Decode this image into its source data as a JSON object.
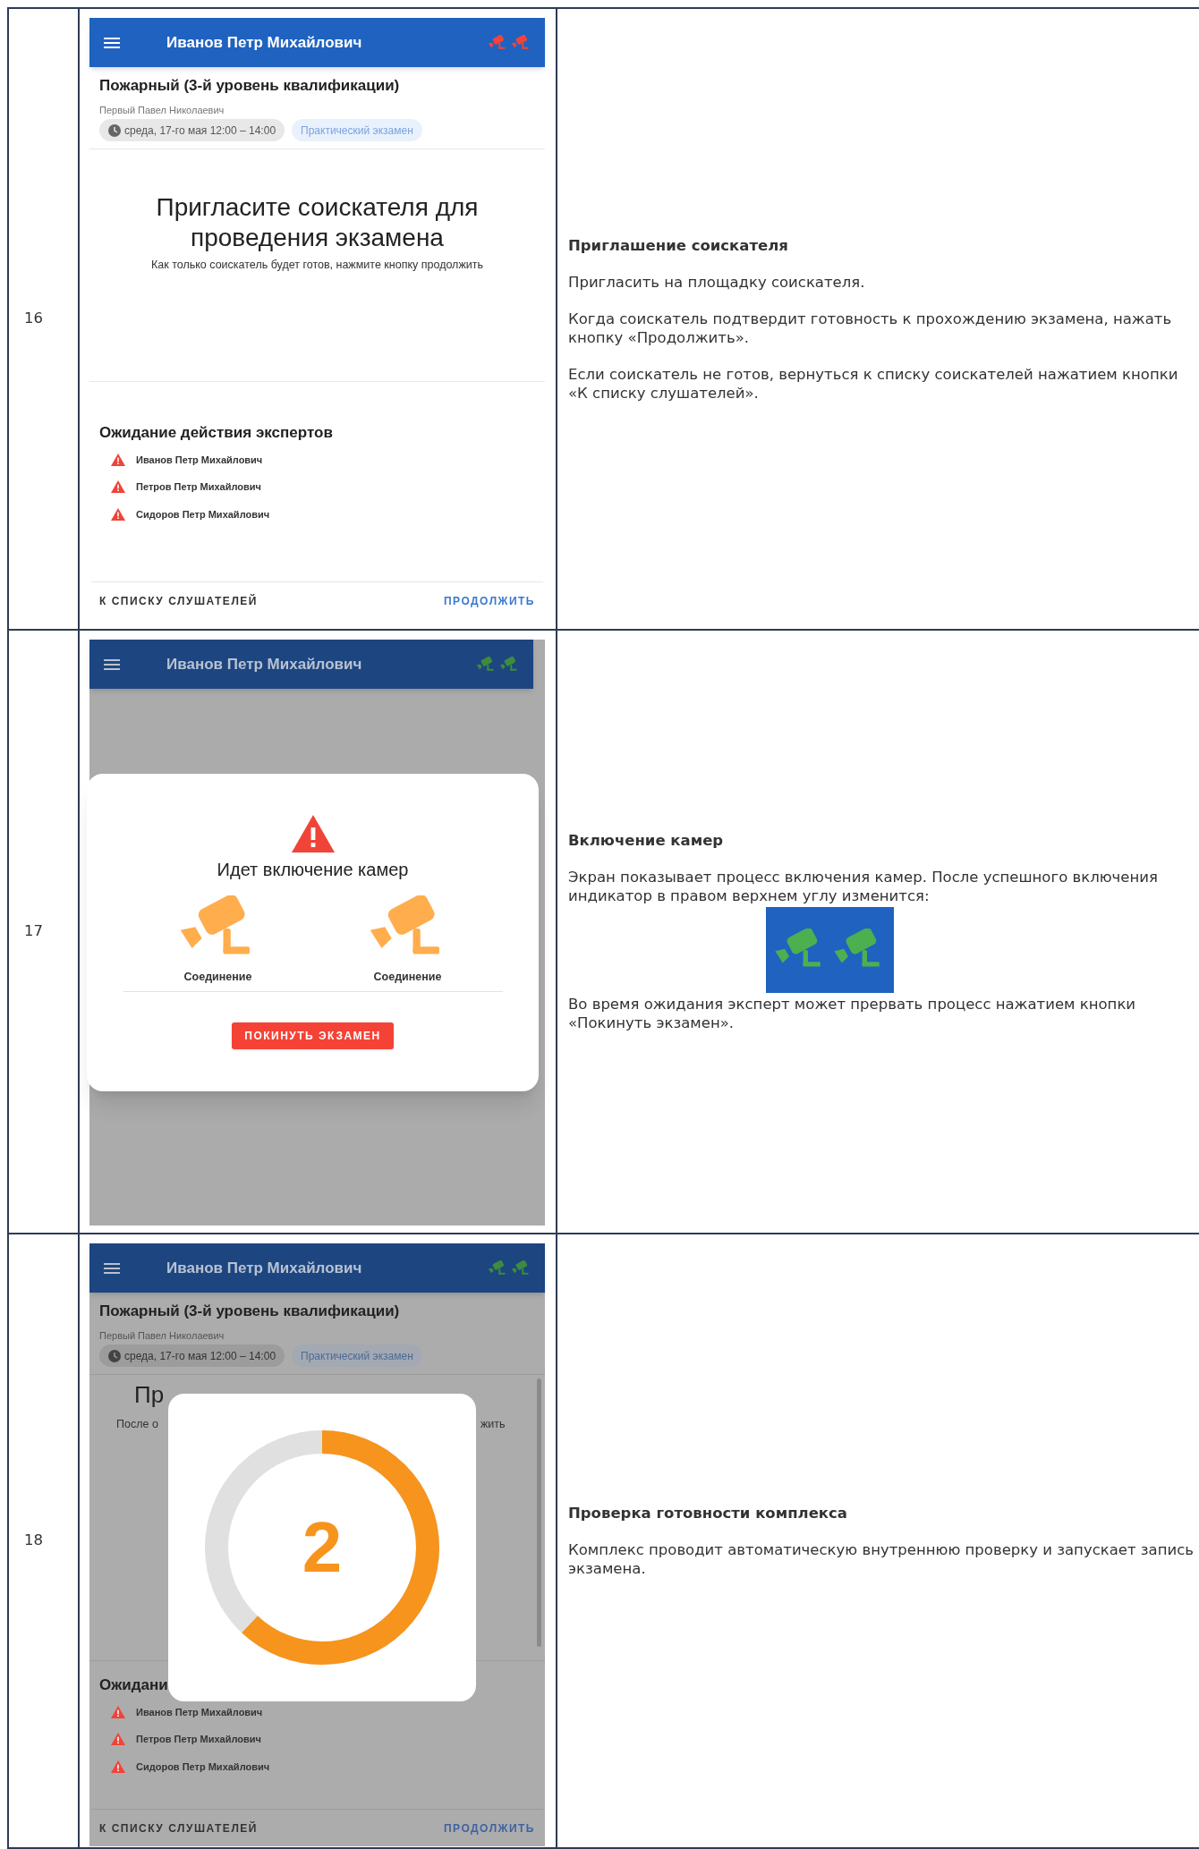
{
  "rows": [
    {
      "number": "16",
      "screen": {
        "kind": "invite",
        "dimmed": false,
        "header": {
          "name": "Иванов Петр Михайлович",
          "cameras_on": false
        },
        "exam": {
          "title": "Пожарный (3-й уровень квалификации)",
          "examiner": "Первый Павел Николаевич",
          "date": "среда, 17-го мая 12:00 – 14:00",
          "badge": "Практический экзамен"
        },
        "invite": {
          "heading": "Пригласите соискателя для проведения экзамена",
          "hint": "Как только соискатель будет готов, нажмите кнопку продолжить"
        },
        "experts": {
          "title": "Ожидание действия экспертов",
          "items": [
            "Иванов Петр Михайлович",
            "Петров Петр Михайлович",
            "Сидоров Петр Михайлович"
          ]
        },
        "footer": {
          "back": "К СПИСКУ СЛУШАТЕЛЕЙ",
          "next": "ПРОДОЛЖИТЬ"
        }
      },
      "description": {
        "title": "Приглашение соискателя",
        "paragraphs": [
          {
            "kind": "text",
            "text": "Пригласить на площадку соискателя."
          },
          {
            "kind": "text",
            "text": "Когда соискатель подтвердит готовность к прохождению экзамена, нажать кнопку «Продолжить»."
          },
          {
            "kind": "text",
            "text": "Если соискатель не готов, вернуться к списку соискателей нажатием кнопки «К списку слушателей»."
          }
        ]
      }
    },
    {
      "number": "17",
      "screen": {
        "kind": "cameras",
        "dimmed": true,
        "header": {
          "name": "Иванов Петр Михайлович",
          "cameras_on": true
        },
        "modal": {
          "title": "Идет включение камер",
          "cameras": [
            {
              "label": "Соединение"
            },
            {
              "label": "Соединение"
            }
          ],
          "button": "ПОКИНУТЬ ЭКЗАМЕН"
        }
      },
      "description": {
        "title": "Включение камер",
        "paragraphs": [
          {
            "kind": "text",
            "text": "Экран показывает процесс включения камер. После успешного включения индикатор в правом верхнем углу изменится:"
          },
          {
            "kind": "indicator",
            "cameras_on": true
          },
          {
            "kind": "text",
            "text": "Во время ожидания эксперт может прервать процесс нажатием кнопки «Покинуть экзамен»."
          }
        ]
      }
    },
    {
      "number": "18",
      "screen": {
        "kind": "countdown",
        "dimmed": true,
        "header": {
          "name": "Иванов Петр Михайлович",
          "cameras_on": true
        },
        "exam": {
          "title": "Пожарный (3-й уровень квалификации)",
          "examiner": "Первый Павел Николаевич",
          "date": "среда, 17-го мая 12:00 – 14:00",
          "badge": "Практический экзамен"
        },
        "covered": {
          "heading_start": "Пр",
          "hint_start": "После о",
          "hint_end": "жить"
        },
        "experts": {
          "title": "Ожидани",
          "items": [
            "Иванов Петр Михайлович",
            "Петров Петр Михайлович",
            "Сидоров Петр Михайлович"
          ]
        },
        "footer": {
          "back": "К СПИСКУ СЛУШАТЕЛЕЙ",
          "next": "ПРОДОЛЖИТЬ"
        },
        "modal": {
          "value": "2",
          "level": 0.62
        }
      },
      "description": {
        "title": "Проверка готовности комплекса",
        "paragraphs": [
          {
            "kind": "text",
            "text": "Комплекс проводит автоматическую внутреннюю проверку и запускает запись экзамена."
          }
        ]
      }
    }
  ]
}
